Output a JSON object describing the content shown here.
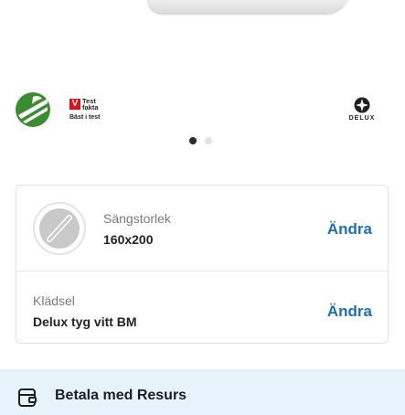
{
  "badges": {
    "swan_icon": "nordic-swan-ecolabel-icon",
    "testfakta": {
      "mark": "V",
      "name": "Test\nfakta",
      "subtitle": "Bäst i test"
    },
    "delux": {
      "icon": "delux-star-icon",
      "text": "DELUX"
    }
  },
  "carousel": {
    "count": 2,
    "active_index": 0
  },
  "options": {
    "size": {
      "label": "Sängstorlek",
      "value": "160x200",
      "action": "Ändra",
      "icon": "bed-size-icon"
    },
    "fabric": {
      "label": "Klädsel",
      "value": "Delux tyg vitt BM",
      "action": "Ändra"
    }
  },
  "payment": {
    "icon": "payment-card-icon",
    "text": "Betala med Resurs"
  },
  "colors": {
    "accent_link": "#1d6fb8",
    "banner_bg": "#e7f3fb",
    "swan_green": "#3c8c32",
    "testfakta_red": "#d7141a"
  }
}
